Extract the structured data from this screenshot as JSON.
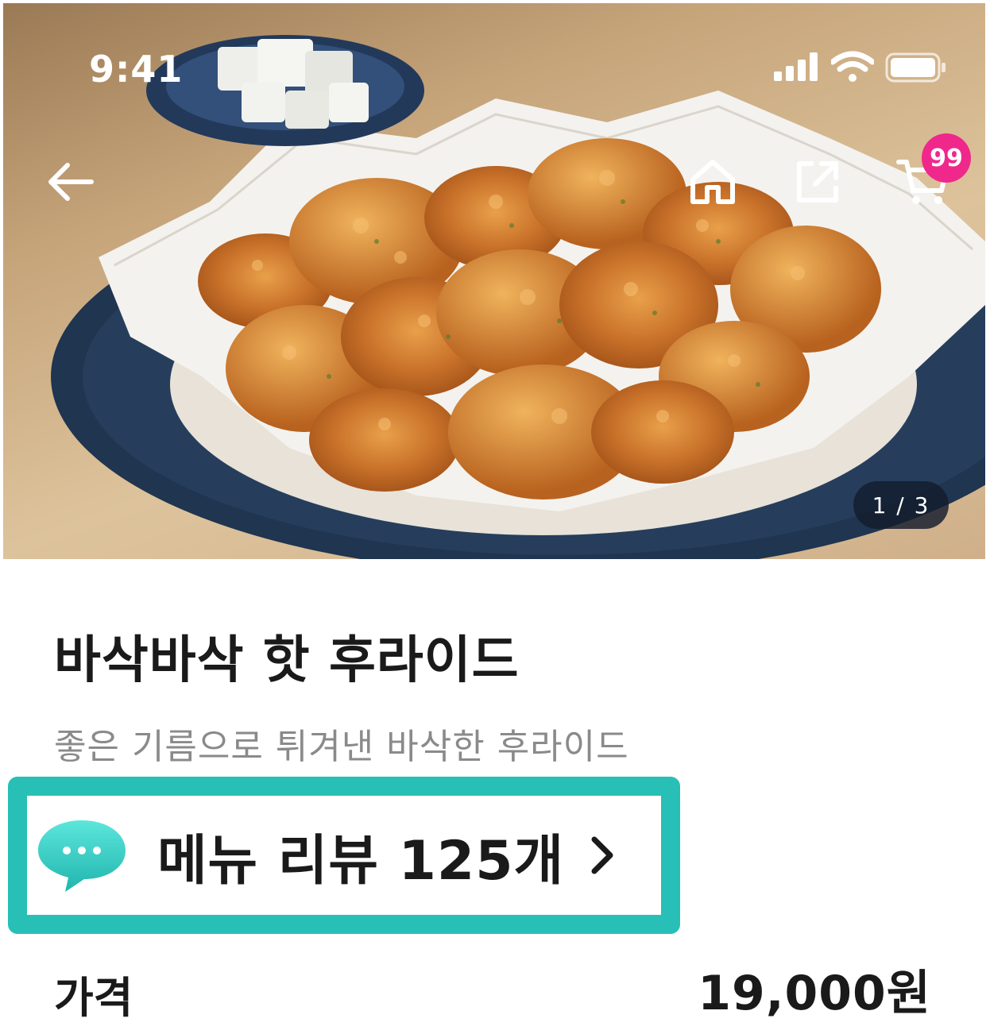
{
  "status_bar": {
    "time": "9:41",
    "signal_icon": "cellular-signal-icon",
    "wifi_icon": "wifi-icon",
    "battery_icon": "battery-icon"
  },
  "nav": {
    "back_icon": "arrow-left-icon",
    "home_icon": "home-icon",
    "share_icon": "share-icon",
    "cart_icon": "cart-icon",
    "cart_badge": "99"
  },
  "hero": {
    "image_pager": "1 / 3"
  },
  "product": {
    "name": "바삭바삭 핫 후라이드",
    "description": "좋은 기름으로 튀겨낸 바삭한 후라이드",
    "review_link": "메뉴 리뷰 125개",
    "review_icon": "chat-bubble-icon",
    "price_label": "가격",
    "price": "19,000원"
  },
  "colors": {
    "highlight": "#27bfb6",
    "badge": "#f0288c",
    "text_primary": "#1a1a1a",
    "text_secondary": "#8a8a8a"
  }
}
